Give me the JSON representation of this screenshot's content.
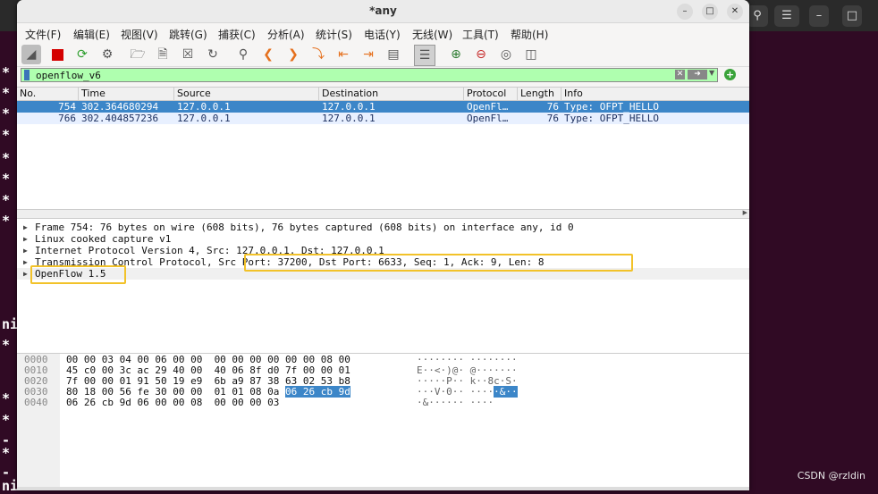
{
  "window": {
    "title": "*any"
  },
  "menu": [
    "文件(F)",
    "编辑(E)",
    "视图(V)",
    "跳转(G)",
    "捕获(C)",
    "分析(A)",
    "统计(S)",
    "电话(Y)",
    "无线(W)",
    "工具(T)",
    "帮助(H)"
  ],
  "filter": {
    "value": "openflow_v6"
  },
  "columns": [
    "No.",
    "Time",
    "Source",
    "Destination",
    "Protocol",
    "Length",
    "Info"
  ],
  "packets": [
    {
      "no": "754",
      "time": "302.364680294",
      "source": "127.0.0.1",
      "destination": "127.0.0.1",
      "protocol": "OpenFl…",
      "length": "76",
      "info": "Type: OFPT_HELLO"
    },
    {
      "no": "766",
      "time": "302.404857236",
      "source": "127.0.0.1",
      "destination": "127.0.0.1",
      "protocol": "OpenFl…",
      "length": "76",
      "info": "Type: OFPT_HELLO"
    }
  ],
  "details": [
    "Frame 754: 76 bytes on wire (608 bits), 76 bytes captured (608 bits) on interface any, id 0",
    "Linux cooked capture v1",
    "Internet Protocol Version 4, Src: 127.0.0.1, Dst: 127.0.0.1",
    "Transmission Control Protocol, Src Port: 37200, Dst Port: 6633, Seq: 1, Ack: 9, Len: 8",
    "OpenFlow 1.5"
  ],
  "bytes": [
    {
      "offset": "0000",
      "hex": "00 00 03 04 00 06 00 00  00 00 00 00 00 00 08 00",
      "ascii": "········ ········"
    },
    {
      "offset": "0010",
      "hex": "45 c0 00 3c ac 29 40 00  40 06 8f d0 7f 00 00 01",
      "ascii": "E··<·)@· @·······"
    },
    {
      "offset": "0020",
      "hex": "7f 00 00 01 91 50 19 e9  6b a9 87 38 63 02 53 b8",
      "ascii": "·····P·· k··8c·S·"
    },
    {
      "offset": "0030",
      "hex_plain": "80 18 00 56 fe 30 00 00  01 01 08 0a ",
      "hex_sel": "06 26 cb 9d",
      "ascii_plain": "···V·0·· ····",
      "ascii_sel": "·&··"
    },
    {
      "offset": "0040",
      "hex": "06 26 cb 9d 06 00 00 08  00 00 00 03",
      "ascii": "·&······ ····"
    }
  ],
  "background": {
    "watermark": "CSDN @rzldin",
    "terminal_glyphs": [
      "*",
      "*",
      "*",
      "*",
      "*",
      "*",
      "*",
      "*",
      "ni",
      "*",
      "*",
      "*",
      "-",
      "*",
      "-",
      "ni"
    ]
  }
}
